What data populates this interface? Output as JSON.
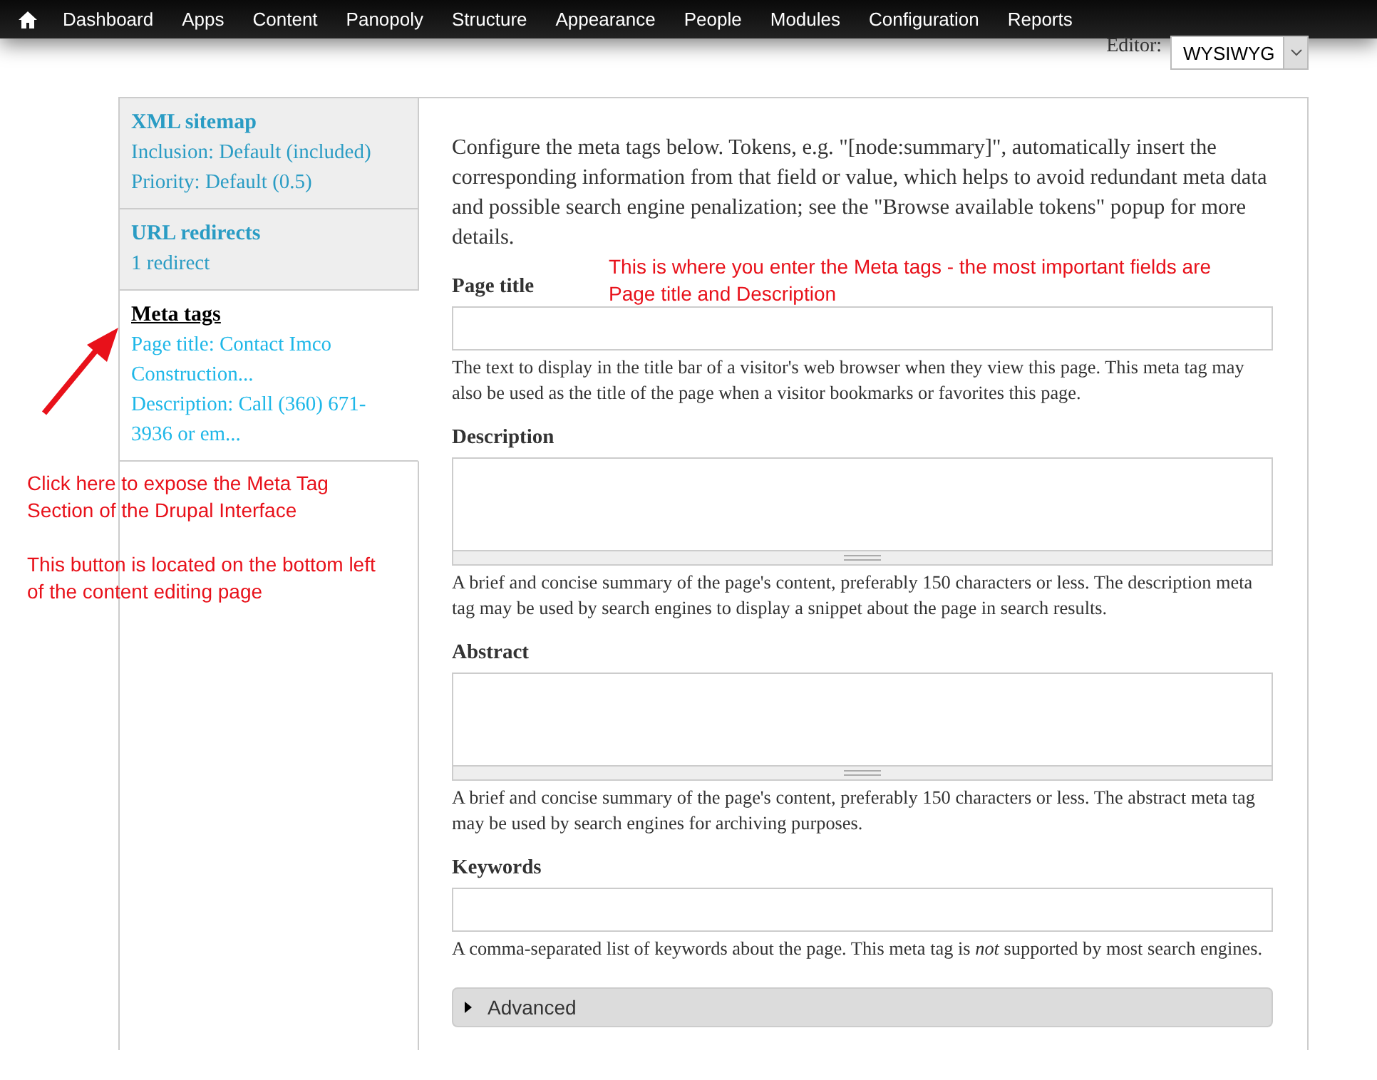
{
  "toolbar": {
    "items": [
      {
        "label": "Dashboard"
      },
      {
        "label": "Apps"
      },
      {
        "label": "Content"
      },
      {
        "label": "Panopoly"
      },
      {
        "label": "Structure"
      },
      {
        "label": "Appearance"
      },
      {
        "label": "People"
      },
      {
        "label": "Modules"
      },
      {
        "label": "Configuration"
      },
      {
        "label": "Reports"
      }
    ]
  },
  "editor": {
    "label": "Editor:",
    "value": "WYSIWYG"
  },
  "vertical_tabs": [
    {
      "title": "XML sitemap",
      "summary": [
        "Inclusion: Default (included)",
        "Priority: Default (0.5)"
      ],
      "selected": false
    },
    {
      "title": "URL redirects",
      "summary": [
        "1 redirect"
      ],
      "selected": false
    },
    {
      "title": "Meta tags",
      "summary": [
        "Page title: Contact Imco Construction...",
        "Description: Call (360) 671-3936 or em..."
      ],
      "selected": true
    }
  ],
  "intro": "Configure the meta tags below. Tokens, e.g. \"[node:summary]\", automatically insert the corresponding information from that field or value, which helps to avoid redundant meta data and possible search engine penalization; see the \"Browse available tokens\" popup for more details.",
  "fields": [
    {
      "kind": "textfield",
      "label": "Page title",
      "description": "The text to display in the title bar of a visitor's web browser when they view this page. This meta tag may also be used as the title of the page when a visitor bookmarks or favorites this page."
    },
    {
      "kind": "textarea",
      "label": "Description",
      "description": "A brief and concise summary of the page's content, preferably 150 characters or less. The description meta tag may be used by search engines to display a snippet about the page in search results."
    },
    {
      "kind": "textarea",
      "label": "Abstract",
      "description": "A brief and concise summary of the page's content, preferably 150 characters or less. The abstract meta tag may be used by search engines for archiving purposes."
    },
    {
      "kind": "textfield",
      "label": "Keywords",
      "description": "A comma-separated list of keywords about the page. This meta tag is *not* supported by most search engines."
    }
  ],
  "advanced": {
    "label": "Advanced",
    "expanded": false
  },
  "annotations": [
    {
      "kind": "fields_note",
      "text": "This is where you enter the Meta tags - the most important fields are Page title and Description"
    },
    {
      "kind": "tab_note",
      "text": "Click here to expose the Meta Tag Section of the Drupal Interface"
    },
    {
      "kind": "tab_note_2",
      "text": "This button is located on the bottom left of the content editing page"
    }
  ]
}
